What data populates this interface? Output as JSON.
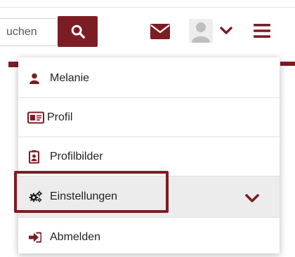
{
  "search": {
    "placeholder": "uchen"
  },
  "user_menu": {
    "items": [
      {
        "label": "Melanie",
        "icon": "user-icon"
      },
      {
        "label": "Profil",
        "icon": "id-card-icon"
      },
      {
        "label": "Profilbilder",
        "icon": "portrait-icon"
      },
      {
        "label": "Einstellungen",
        "icon": "cogs-icon"
      },
      {
        "label": "Abmelden",
        "icon": "sign-out-icon"
      }
    ]
  },
  "colors": {
    "accent": "#7c1d24",
    "active_row": "#ececec",
    "avatar": "#bfbfbf"
  }
}
